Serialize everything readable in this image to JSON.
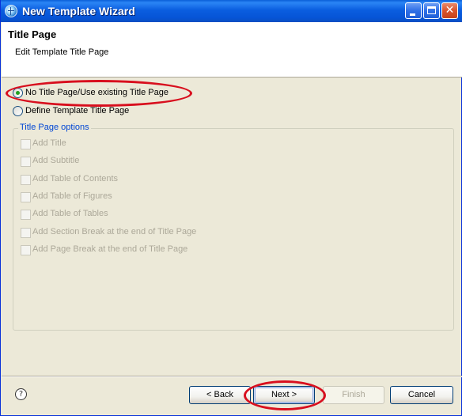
{
  "window": {
    "title": "New Template Wizard",
    "minimize_icon": "minimize-icon",
    "maximize_icon": "maximize-icon",
    "close_icon": "close-icon",
    "close_glyph": "✕"
  },
  "header": {
    "title": "Title Page",
    "description": "Edit Template Title Page"
  },
  "options": {
    "no_title_page": "No Title Page/Use existing Title Page",
    "no_title_page_selected": true,
    "define_title_page": "Define Template Title Page",
    "define_title_page_selected": false
  },
  "title_page_options": {
    "legend": "Title Page options",
    "enabled": false,
    "items": [
      {
        "label": "Add Title",
        "checked": false
      },
      {
        "label": "Add Subtitle",
        "checked": false
      },
      {
        "label": "Add Table of Contents",
        "checked": false
      },
      {
        "label": "Add Table of Figures",
        "checked": false
      },
      {
        "label": "Add Table of Tables",
        "checked": false
      },
      {
        "label": "Add Section Break at the end of Title Page",
        "checked": false
      },
      {
        "label": "Add Page Break at the end of Title Page",
        "checked": false
      }
    ]
  },
  "footer": {
    "help_glyph": "?",
    "back_label": "< Back",
    "next_label": "Next >",
    "finish_label": "Finish",
    "finish_enabled": false,
    "cancel_label": "Cancel"
  },
  "annotation": {
    "highlight_color": "#d80f1e"
  },
  "colors": {
    "titlebar": "#0654d6",
    "dialog_background": "#ece9d8",
    "group_legend": "#0046d5",
    "disabled_text": "#aca899"
  }
}
